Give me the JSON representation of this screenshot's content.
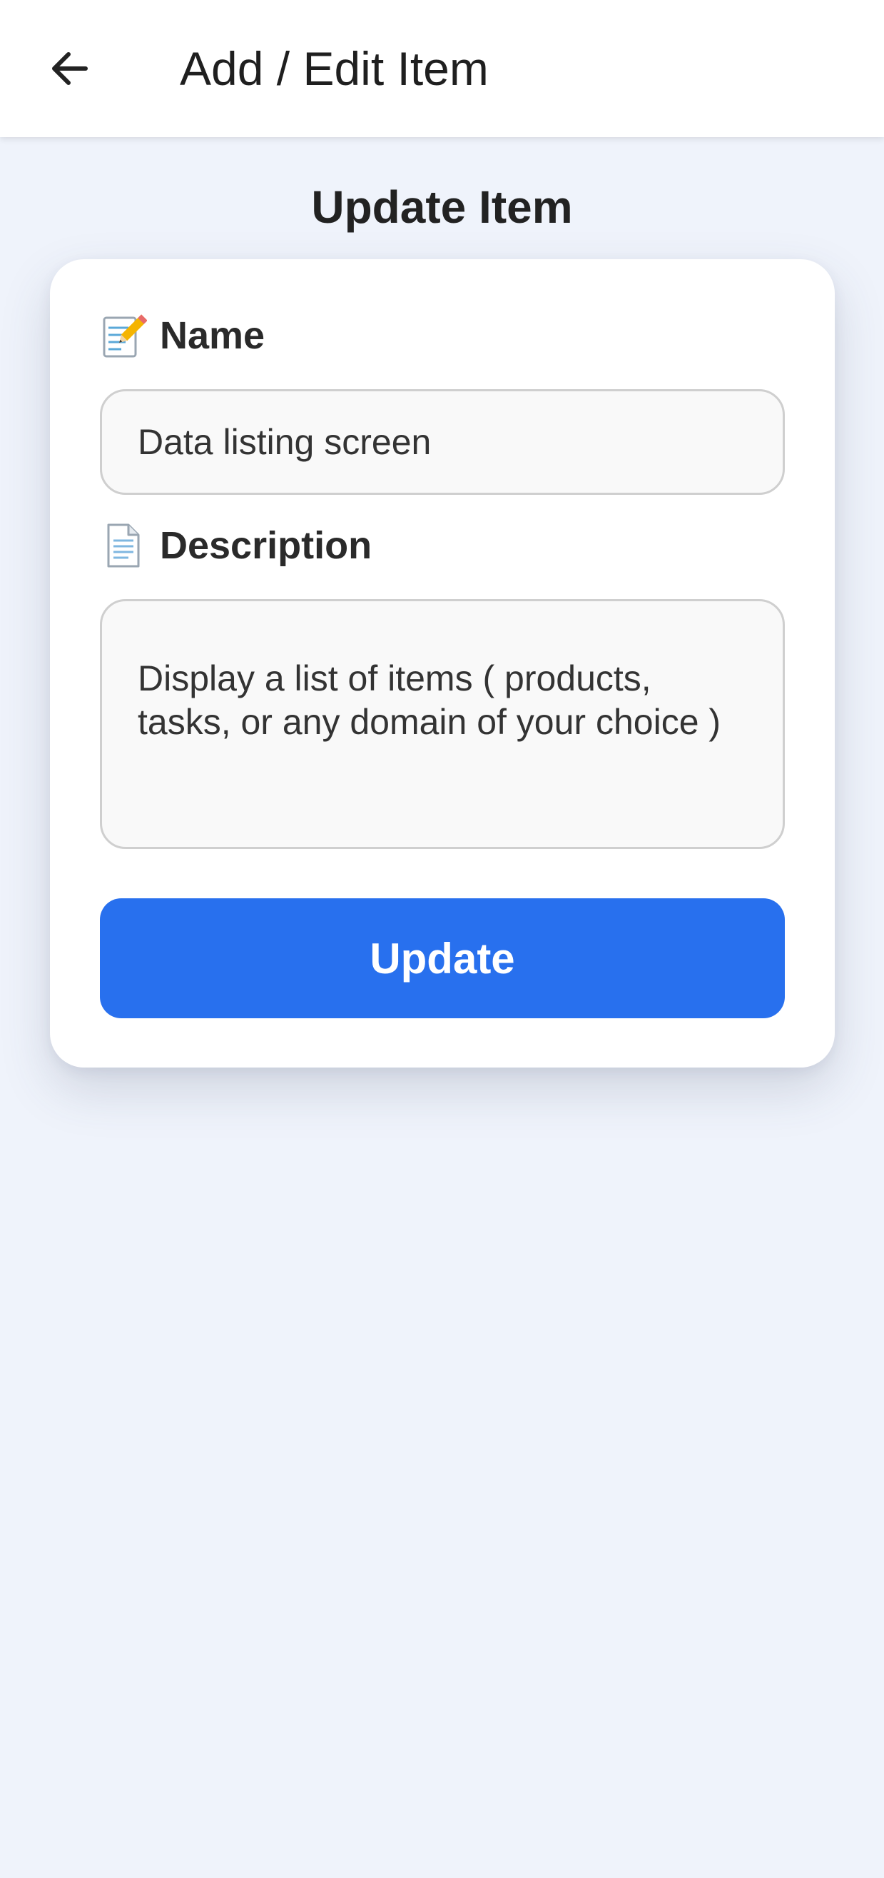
{
  "appbar": {
    "back_icon": "arrow-left-icon",
    "title": "Add / Edit Item"
  },
  "page": {
    "title": "Update Item"
  },
  "form": {
    "name": {
      "icon": "memo-pencil-icon",
      "label": "Name",
      "value": "Data listing screen"
    },
    "description": {
      "icon": "document-icon",
      "label": "Description",
      "value": "Display a list of items ( products, tasks, or any domain of your choice )"
    },
    "submit_label": "Update"
  },
  "colors": {
    "accent": "#2870ee",
    "background": "#eff3fb",
    "card": "#ffffff"
  }
}
